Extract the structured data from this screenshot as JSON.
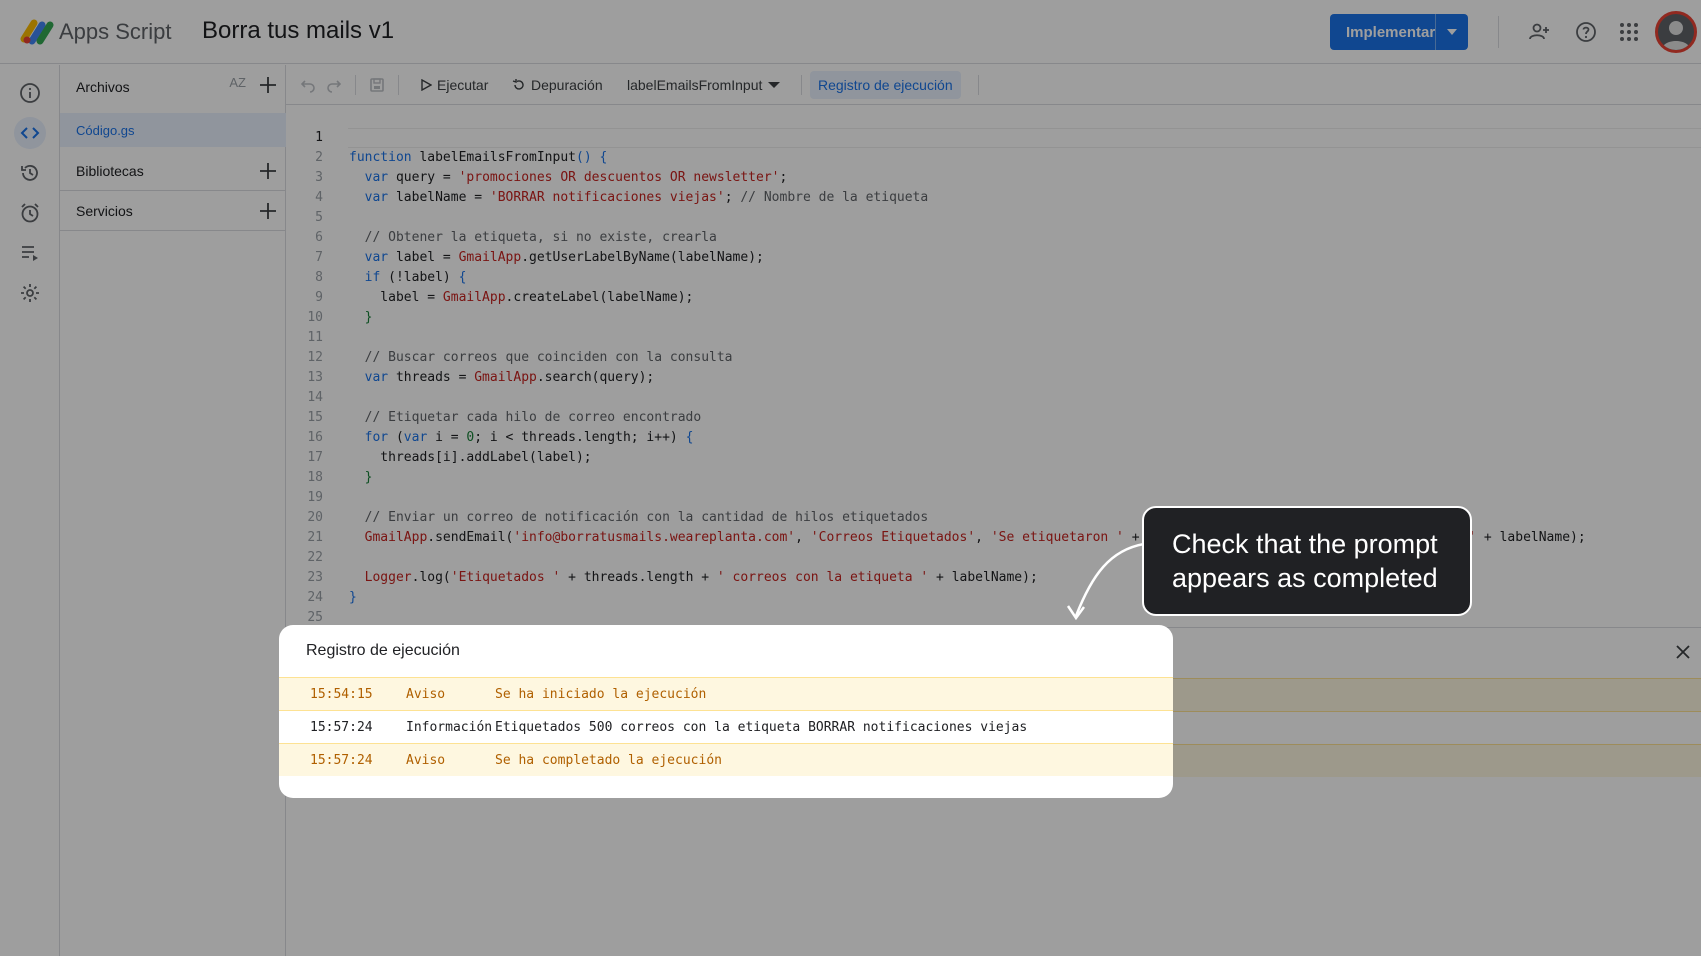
{
  "header": {
    "app_name": "Apps Script",
    "project_title": "Borra tus mails v1",
    "deploy_label": "Implementar",
    "icons": [
      "add-person-icon",
      "help-icon",
      "apps-grid-icon"
    ]
  },
  "rail": {
    "icons": [
      "info-icon",
      "code-icon",
      "history-icon",
      "alarm-icon",
      "executions-icon",
      "settings-icon"
    ]
  },
  "files": {
    "header": "Archivos",
    "sort_label": "AZ",
    "file": "Código.gs",
    "libraries": "Bibliotecas",
    "services": "Servicios"
  },
  "toolbar": {
    "run": "Ejecutar",
    "debug": "Depuración",
    "function": "labelEmailsFromInput",
    "log": "Registro de ejecución"
  },
  "code": {
    "line_numbers": [
      "1",
      "2",
      "3",
      "4",
      "5",
      "6",
      "7",
      "8",
      "9",
      "10",
      "11",
      "12",
      "13",
      "14",
      "15",
      "16",
      "17",
      "18",
      "19",
      "20",
      "21",
      "22",
      "23",
      "24",
      "25"
    ]
  },
  "log": {
    "title": "Registro de ejecución",
    "rows": [
      {
        "time": "15:54:15",
        "level": "Aviso",
        "message": "Se ha iniciado la ejecución"
      },
      {
        "time": "15:57:24",
        "level": "Información",
        "message": "Etiquetados 500 correos con la etiqueta BORRAR notificaciones viejas"
      },
      {
        "time": "15:57:24",
        "level": "Aviso",
        "message": "Se ha completado la ejecución"
      }
    ]
  },
  "callout": {
    "text": "Check that the prompt appears as completed"
  },
  "colors": {
    "accent": "#1a73e8",
    "warn_bg": "#fef7e0",
    "warn_text": "#b06000"
  }
}
